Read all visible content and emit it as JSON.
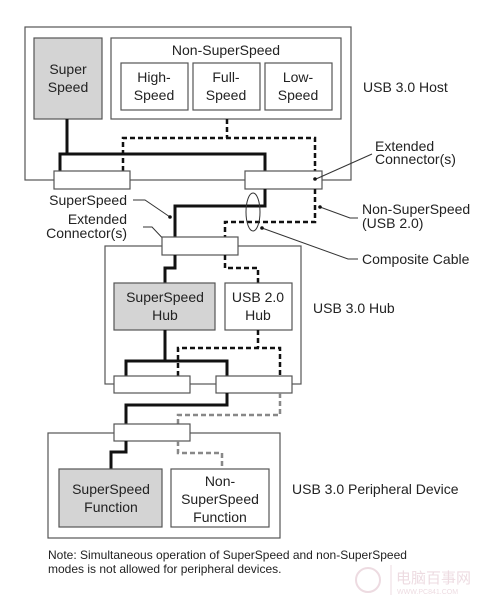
{
  "host": {
    "label": "USB 3.0 Host",
    "superspeed": [
      "Super",
      "Speed"
    ],
    "non_superspeed_title": "Non-SuperSpeed",
    "speeds": [
      [
        "High-",
        "Speed"
      ],
      [
        "Full-",
        "Speed"
      ],
      [
        "Low-",
        "Speed"
      ]
    ]
  },
  "callouts": {
    "extended_connector_right": [
      "Extended",
      "Connector(s)"
    ],
    "superspeed": "SuperSpeed",
    "extended_connector_left": [
      "Extended",
      "Connector(s)"
    ],
    "non_superspeed": [
      "Non-SuperSpeed",
      "(USB 2.0)"
    ],
    "composite_cable": "Composite Cable"
  },
  "hub": {
    "label": "USB 3.0 Hub",
    "superspeed_hub": [
      "SuperSpeed",
      "Hub"
    ],
    "usb2_hub": [
      "USB 2.0",
      "Hub"
    ]
  },
  "device": {
    "label": "USB 3.0 Peripheral Device",
    "superspeed_function": [
      "SuperSpeed",
      "Function"
    ],
    "non_superspeed_function": [
      "Non-",
      "SuperSpeed",
      "Function"
    ]
  },
  "note": [
    "Note: Simultaneous operation of SuperSpeed and non-SuperSpeed",
    "modes is not allowed for peripheral devices."
  ],
  "watermark": [
    "电脑百事网",
    "WWW.PC841.COM"
  ]
}
